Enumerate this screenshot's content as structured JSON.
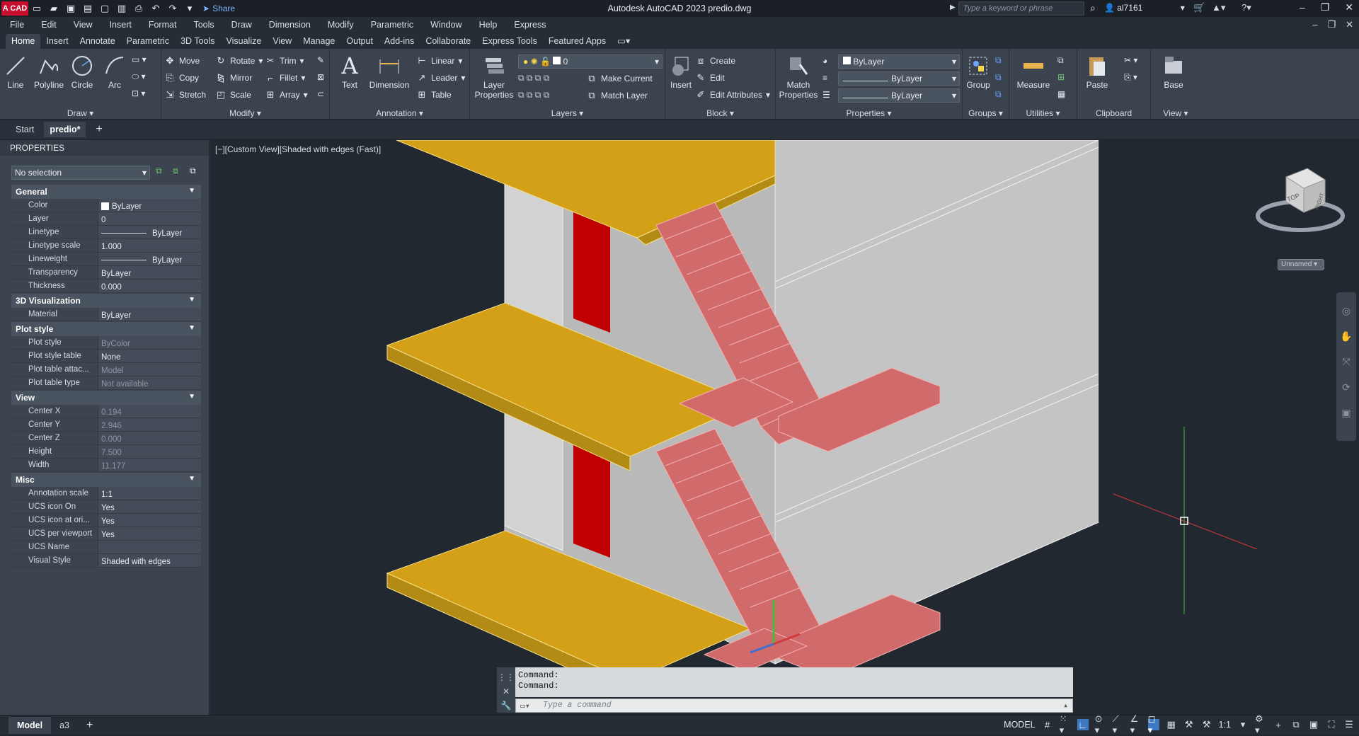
{
  "titlebar": {
    "logo": "A CAD",
    "share": "Share",
    "title": "Autodesk AutoCAD 2023   predio.dwg",
    "search_placeholder": "Type a keyword or phrase",
    "user": "al7161"
  },
  "menubar": {
    "items": [
      "File",
      "Edit",
      "View",
      "Insert",
      "Format",
      "Tools",
      "Draw",
      "Dimension",
      "Modify",
      "Parametric",
      "Window",
      "Help",
      "Express"
    ]
  },
  "ribbon_tabs": [
    "Home",
    "Insert",
    "Annotate",
    "Parametric",
    "3D Tools",
    "Visualize",
    "View",
    "Manage",
    "Output",
    "Add-ins",
    "Collaborate",
    "Express Tools",
    "Featured Apps"
  ],
  "ribbon": {
    "draw": {
      "title": "Draw",
      "line": "Line",
      "polyline": "Polyline",
      "circle": "Circle",
      "arc": "Arc"
    },
    "modify": {
      "title": "Modify",
      "move": "Move",
      "rotate": "Rotate",
      "trim": "Trim",
      "copy": "Copy",
      "mirror": "Mirror",
      "fillet": "Fillet",
      "stretch": "Stretch",
      "scale": "Scale",
      "array": "Array"
    },
    "annotation": {
      "title": "Annotation",
      "text": "Text",
      "dimension": "Dimension",
      "linear": "Linear",
      "leader": "Leader",
      "table": "Table"
    },
    "layers": {
      "title": "Layers",
      "layer_properties_1": "Layer",
      "layer_properties_2": "Properties",
      "current_layer": "0",
      "make_current": "Make Current",
      "match_layer": "Match Layer"
    },
    "block": {
      "title": "Block",
      "insert": "Insert",
      "create": "Create",
      "edit": "Edit",
      "edit_attributes": "Edit Attributes"
    },
    "properties": {
      "title": "Properties",
      "match_1": "Match",
      "match_2": "Properties",
      "color": "ByLayer",
      "lineweight": "ByLayer",
      "linetype": "ByLayer"
    },
    "groups": {
      "title": "Groups",
      "group": "Group"
    },
    "utilities": {
      "title": "Utilities",
      "measure": "Measure"
    },
    "clipboard": {
      "title": "Clipboard",
      "paste": "Paste"
    },
    "view": {
      "title": "View",
      "base": "Base"
    }
  },
  "doc_tabs": [
    "Start",
    "predio*"
  ],
  "properties_palette": {
    "header": "PROPERTIES",
    "selection": "No selection",
    "categories": [
      {
        "name": "General",
        "rows": [
          {
            "name": "Color",
            "value": "ByLayer"
          },
          {
            "name": "Layer",
            "value": "0"
          },
          {
            "name": "Linetype",
            "value": "ByLayer"
          },
          {
            "name": "Linetype scale",
            "value": "1.000"
          },
          {
            "name": "Lineweight",
            "value": "ByLayer"
          },
          {
            "name": "Transparency",
            "value": "ByLayer"
          },
          {
            "name": "Thickness",
            "value": "0.000"
          }
        ]
      },
      {
        "name": "3D Visualization",
        "rows": [
          {
            "name": "Material",
            "value": "ByLayer"
          }
        ]
      },
      {
        "name": "Plot style",
        "rows": [
          {
            "name": "Plot style",
            "value": "ByColor"
          },
          {
            "name": "Plot style table",
            "value": "None"
          },
          {
            "name": "Plot table attac...",
            "value": "Model"
          },
          {
            "name": "Plot table type",
            "value": "Not available"
          }
        ]
      },
      {
        "name": "View",
        "rows": [
          {
            "name": "Center X",
            "value": "0.194"
          },
          {
            "name": "Center Y",
            "value": "2.946"
          },
          {
            "name": "Center Z",
            "value": "0.000"
          },
          {
            "name": "Height",
            "value": "7.500"
          },
          {
            "name": "Width",
            "value": "11.177"
          }
        ]
      },
      {
        "name": "Misc",
        "rows": [
          {
            "name": "Annotation scale",
            "value": "1:1"
          },
          {
            "name": "UCS icon On",
            "value": "Yes"
          },
          {
            "name": "UCS icon at ori...",
            "value": "Yes"
          },
          {
            "name": "UCS per viewport",
            "value": "Yes"
          },
          {
            "name": "UCS Name",
            "value": ""
          },
          {
            "name": "Visual Style",
            "value": "Shaded with edges"
          }
        ]
      }
    ]
  },
  "viewport": {
    "label": "[−][Custom View][Shaded with edges (Fast)]",
    "viewcube_top": "TOP",
    "viewcube_right": "RIGHT",
    "ucs_name": "Unnamed"
  },
  "command": {
    "history": [
      "Command:",
      "Command:"
    ],
    "placeholder": "Type a command"
  },
  "status": {
    "layout_tabs": [
      "Model",
      "a3"
    ],
    "model": "MODEL",
    "scale": "1:1"
  }
}
